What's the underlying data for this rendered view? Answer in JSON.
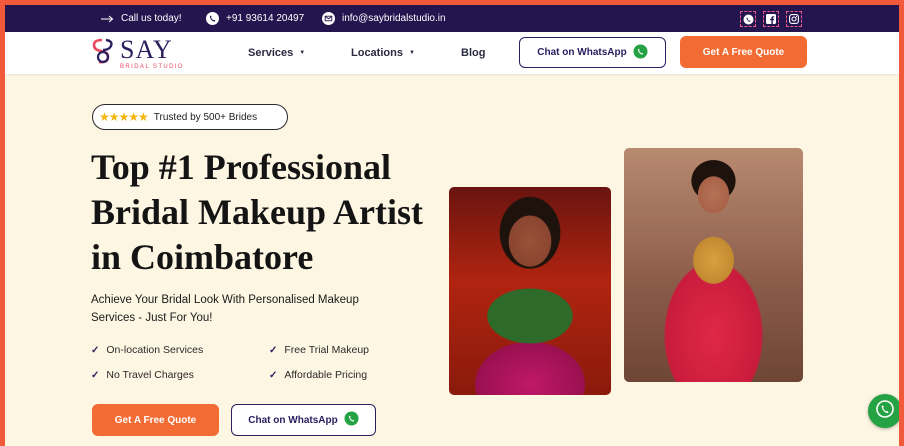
{
  "topbar": {
    "call_label": "Call us today!",
    "phone": "+91 93614 20497",
    "email": "info@saybridalstudio.in",
    "social_icons": [
      "whatsapp-icon",
      "facebook-icon",
      "instagram-icon"
    ]
  },
  "nav": {
    "logo_main": "SAY",
    "logo_sub": "BRIDAL STUDIO",
    "links": [
      {
        "label": "Services",
        "caret": "▼"
      },
      {
        "label": "Locations",
        "caret": "▼"
      },
      {
        "label": "Blog"
      }
    ],
    "whatsapp_label": "Chat on WhatsApp",
    "quote_label": "Get A Free Quote"
  },
  "hero": {
    "badge_stars": "★★★★★",
    "badge_text": "Trusted by 500+ Brides",
    "title_lines": [
      "Top #1 Professional",
      "Bridal Makeup Artist",
      "in Coimbatore"
    ],
    "subtitle_lines": [
      "Achieve Your Bridal Look With Personalised Makeup",
      "Services - Just For You!"
    ],
    "features": [
      "On-location Services",
      "Free Trial Makeup",
      "No Travel Charges",
      "Affordable Pricing"
    ],
    "check_glyph": "✓",
    "quote_label": "Get A Free Quote",
    "whatsapp_label": "Chat on WhatsApp"
  },
  "colors": {
    "brand_navy": "#24154f",
    "accent_orange": "#f26b32",
    "whatsapp_green": "#25a244",
    "background_cream": "#fdf6e3",
    "frame_orange": "#f05a3a"
  }
}
